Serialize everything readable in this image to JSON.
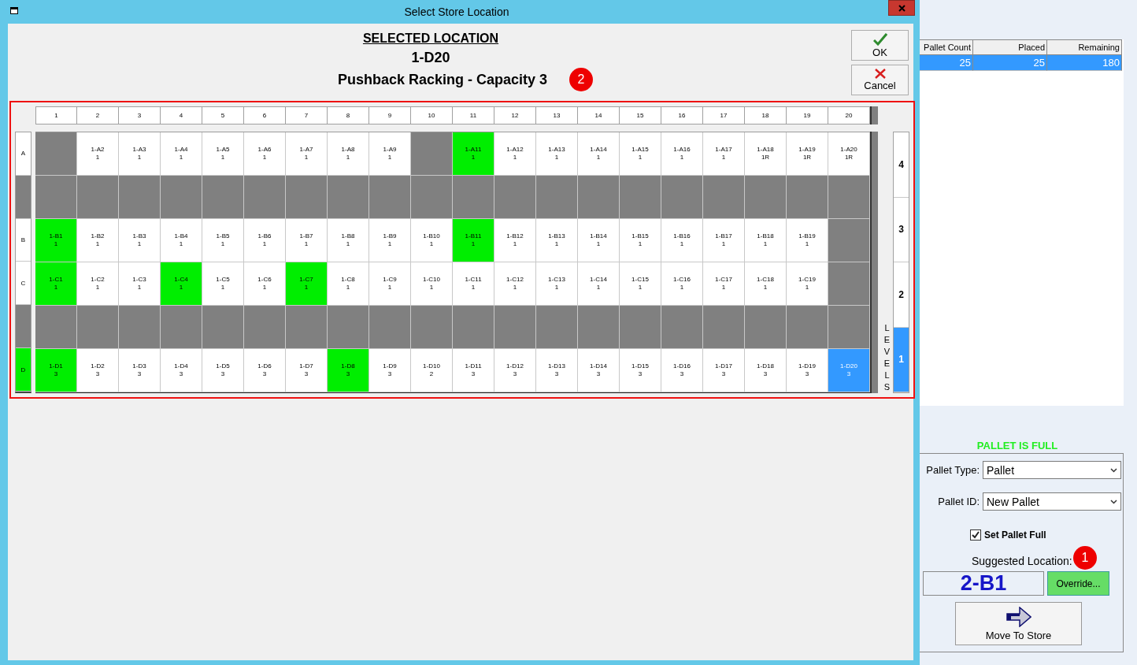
{
  "window": {
    "title": "Select Store Location"
  },
  "header": {
    "heading": "SELECTED LOCATION",
    "location": "1-D20",
    "description": "Pushback Racking - Capacity 3",
    "badge": "2"
  },
  "dialog_buttons": [
    {
      "kind": "ok",
      "label": "OK"
    },
    {
      "kind": "cancel",
      "label": "Cancel"
    }
  ],
  "grid": {
    "columns": [
      "1",
      "2",
      "3",
      "4",
      "5",
      "6",
      "7",
      "8",
      "9",
      "10",
      "11",
      "12",
      "13",
      "14",
      "15",
      "16",
      "17",
      "18",
      "19",
      "20"
    ],
    "rows": [
      {
        "label": "A",
        "color": "#ffffff",
        "cells": [
          {
            "color": "#808080"
          },
          {
            "code": "1-A2",
            "qty": "1",
            "color": "#ffffff",
            "selected": false
          },
          {
            "code": "1-A3",
            "qty": "1",
            "color": "#ffffff",
            "selected": false
          },
          {
            "code": "1-A4",
            "qty": "1",
            "color": "#ffffff",
            "selected": false
          },
          {
            "code": "1-A5",
            "qty": "1",
            "color": "#ffffff",
            "selected": false
          },
          {
            "code": "1-A6",
            "qty": "1",
            "color": "#ffffff",
            "selected": false
          },
          {
            "code": "1-A7",
            "qty": "1",
            "color": "#ffffff",
            "selected": false
          },
          {
            "code": "1-A8",
            "qty": "1",
            "color": "#ffffff",
            "selected": false
          },
          {
            "code": "1-A9",
            "qty": "1",
            "color": "#ffffff",
            "selected": false
          },
          {
            "color": "#808080"
          },
          {
            "code": "1-A11",
            "qty": "1",
            "color": "#00ee00",
            "selected": false
          },
          {
            "code": "1-A12",
            "qty": "1",
            "color": "#ffffff",
            "selected": false
          },
          {
            "code": "1-A13",
            "qty": "1",
            "color": "#ffffff",
            "selected": false
          },
          {
            "code": "1-A14",
            "qty": "1",
            "color": "#ffffff",
            "selected": false
          },
          {
            "code": "1-A15",
            "qty": "1",
            "color": "#ffffff",
            "selected": false
          },
          {
            "code": "1-A16",
            "qty": "1",
            "color": "#ffffff",
            "selected": false
          },
          {
            "code": "1-A17",
            "qty": "1",
            "color": "#ffffff",
            "selected": false
          },
          {
            "code": "1-A18",
            "qty": "1R",
            "color": "#ffffff",
            "selected": false
          },
          {
            "code": "1-A19",
            "qty": "1R",
            "color": "#ffffff",
            "selected": false
          },
          {
            "code": "1-A20",
            "qty": "1R",
            "color": "#ffffff",
            "selected": false
          }
        ]
      },
      {
        "color": "#808080",
        "cells": [
          {
            "color": "#808080"
          },
          {
            "color": "#808080"
          },
          {
            "color": "#808080"
          },
          {
            "color": "#808080"
          },
          {
            "color": "#808080"
          },
          {
            "color": "#808080"
          },
          {
            "color": "#808080"
          },
          {
            "color": "#808080"
          },
          {
            "color": "#808080"
          },
          {
            "color": "#808080"
          },
          {
            "color": "#808080"
          },
          {
            "color": "#808080"
          },
          {
            "color": "#808080"
          },
          {
            "color": "#808080"
          },
          {
            "color": "#808080"
          },
          {
            "color": "#808080"
          },
          {
            "color": "#808080"
          },
          {
            "color": "#808080"
          },
          {
            "color": "#808080"
          },
          {
            "color": "#808080"
          }
        ]
      },
      {
        "label": "B",
        "color": "#ffffff",
        "cells": [
          {
            "code": "1-B1",
            "qty": "1",
            "color": "#00ee00",
            "selected": false
          },
          {
            "code": "1-B2",
            "qty": "1",
            "color": "#ffffff",
            "selected": false
          },
          {
            "code": "1-B3",
            "qty": "1",
            "color": "#ffffff",
            "selected": false
          },
          {
            "code": "1-B4",
            "qty": "1",
            "color": "#ffffff",
            "selected": false
          },
          {
            "code": "1-B5",
            "qty": "1",
            "color": "#ffffff",
            "selected": false
          },
          {
            "code": "1-B6",
            "qty": "1",
            "color": "#ffffff",
            "selected": false
          },
          {
            "code": "1-B7",
            "qty": "1",
            "color": "#ffffff",
            "selected": false
          },
          {
            "code": "1-B8",
            "qty": "1",
            "color": "#ffffff",
            "selected": false
          },
          {
            "code": "1-B9",
            "qty": "1",
            "color": "#ffffff",
            "selected": false
          },
          {
            "code": "1-B10",
            "qty": "1",
            "color": "#ffffff",
            "selected": false
          },
          {
            "code": "1-B11",
            "qty": "1",
            "color": "#00ee00",
            "selected": false
          },
          {
            "code": "1-B12",
            "qty": "1",
            "color": "#ffffff",
            "selected": false
          },
          {
            "code": "1-B13",
            "qty": "1",
            "color": "#ffffff",
            "selected": false
          },
          {
            "code": "1-B14",
            "qty": "1",
            "color": "#ffffff",
            "selected": false
          },
          {
            "code": "1-B15",
            "qty": "1",
            "color": "#ffffff",
            "selected": false
          },
          {
            "code": "1-B16",
            "qty": "1",
            "color": "#ffffff",
            "selected": false
          },
          {
            "code": "1-B17",
            "qty": "1",
            "color": "#ffffff",
            "selected": false
          },
          {
            "code": "1-B18",
            "qty": "1",
            "color": "#ffffff",
            "selected": false
          },
          {
            "code": "1-B19",
            "qty": "1",
            "color": "#ffffff",
            "selected": false
          },
          {
            "color": "#808080"
          }
        ]
      },
      {
        "label": "C",
        "color": "#ffffff",
        "cells": [
          {
            "code": "1-C1",
            "qty": "1",
            "color": "#00ee00",
            "selected": false
          },
          {
            "code": "1-C2",
            "qty": "1",
            "color": "#ffffff",
            "selected": false
          },
          {
            "code": "1-C3",
            "qty": "1",
            "color": "#ffffff",
            "selected": false
          },
          {
            "code": "1-C4",
            "qty": "1",
            "color": "#00ee00",
            "selected": false
          },
          {
            "code": "1-C5",
            "qty": "1",
            "color": "#ffffff",
            "selected": false
          },
          {
            "code": "1-C6",
            "qty": "1",
            "color": "#ffffff",
            "selected": false
          },
          {
            "code": "1-C7",
            "qty": "1",
            "color": "#00ee00",
            "selected": false
          },
          {
            "code": "1-C8",
            "qty": "1",
            "color": "#ffffff",
            "selected": false
          },
          {
            "code": "1-C9",
            "qty": "1",
            "color": "#ffffff",
            "selected": false
          },
          {
            "code": "1-C10",
            "qty": "1",
            "color": "#ffffff",
            "selected": false
          },
          {
            "code": "1-C11",
            "qty": "1",
            "color": "#ffffff",
            "selected": false
          },
          {
            "code": "1-C12",
            "qty": "1",
            "color": "#ffffff",
            "selected": false
          },
          {
            "code": "1-C13",
            "qty": "1",
            "color": "#ffffff",
            "selected": false
          },
          {
            "code": "1-C14",
            "qty": "1",
            "color": "#ffffff",
            "selected": false
          },
          {
            "code": "1-C15",
            "qty": "1",
            "color": "#ffffff",
            "selected": false
          },
          {
            "code": "1-C16",
            "qty": "1",
            "color": "#ffffff",
            "selected": false
          },
          {
            "code": "1-C17",
            "qty": "1",
            "color": "#ffffff",
            "selected": false
          },
          {
            "code": "1-C18",
            "qty": "1",
            "color": "#ffffff",
            "selected": false
          },
          {
            "code": "1-C19",
            "qty": "1",
            "color": "#ffffff",
            "selected": false
          },
          {
            "color": "#808080"
          }
        ]
      },
      {
        "color": "#808080",
        "cells": [
          {
            "color": "#808080"
          },
          {
            "color": "#808080"
          },
          {
            "color": "#808080"
          },
          {
            "color": "#808080"
          },
          {
            "color": "#808080"
          },
          {
            "color": "#808080"
          },
          {
            "color": "#808080"
          },
          {
            "color": "#808080"
          },
          {
            "color": "#808080"
          },
          {
            "color": "#808080"
          },
          {
            "color": "#808080"
          },
          {
            "color": "#808080"
          },
          {
            "color": "#808080"
          },
          {
            "color": "#808080"
          },
          {
            "color": "#808080"
          },
          {
            "color": "#808080"
          },
          {
            "color": "#808080"
          },
          {
            "color": "#808080"
          },
          {
            "color": "#808080"
          },
          {
            "color": "#808080"
          }
        ]
      },
      {
        "label": "D",
        "color": "#00ee00",
        "cells": [
          {
            "code": "1-D1",
            "qty": "3",
            "color": "#00ee00",
            "selected": false
          },
          {
            "code": "1-D2",
            "qty": "3",
            "color": "#ffffff",
            "selected": false
          },
          {
            "code": "1-D3",
            "qty": "3",
            "color": "#ffffff",
            "selected": false
          },
          {
            "code": "1-D4",
            "qty": "3",
            "color": "#ffffff",
            "selected": false
          },
          {
            "code": "1-D5",
            "qty": "3",
            "color": "#ffffff",
            "selected": false
          },
          {
            "code": "1-D6",
            "qty": "3",
            "color": "#ffffff",
            "selected": false
          },
          {
            "code": "1-D7",
            "qty": "3",
            "color": "#ffffff",
            "selected": false
          },
          {
            "code": "1-D8",
            "qty": "3",
            "color": "#00ee00",
            "selected": false
          },
          {
            "code": "1-D9",
            "qty": "3",
            "color": "#ffffff",
            "selected": false
          },
          {
            "code": "1-D10",
            "qty": "2",
            "color": "#ffffff",
            "selected": false
          },
          {
            "code": "1-D11",
            "qty": "3",
            "color": "#ffffff",
            "selected": false
          },
          {
            "code": "1-D12",
            "qty": "3",
            "color": "#ffffff",
            "selected": false
          },
          {
            "code": "1-D13",
            "qty": "3",
            "color": "#ffffff",
            "selected": false
          },
          {
            "code": "1-D14",
            "qty": "3",
            "color": "#ffffff",
            "selected": false
          },
          {
            "code": "1-D15",
            "qty": "3",
            "color": "#ffffff",
            "selected": false
          },
          {
            "code": "1-D16",
            "qty": "3",
            "color": "#ffffff",
            "selected": false
          },
          {
            "code": "1-D17",
            "qty": "3",
            "color": "#ffffff",
            "selected": false
          },
          {
            "code": "1-D18",
            "qty": "3",
            "color": "#ffffff",
            "selected": false
          },
          {
            "code": "1-D19",
            "qty": "3",
            "color": "#ffffff",
            "selected": false
          },
          {
            "code": "1-D20",
            "qty": "3",
            "color": "#3399ff",
            "selected": true
          }
        ]
      }
    ],
    "levels_caption": "LEVELS",
    "levels": [
      {
        "label": "4",
        "selected": false
      },
      {
        "label": "3",
        "selected": false
      },
      {
        "label": "2",
        "selected": false
      },
      {
        "label": "1",
        "selected": true
      }
    ]
  },
  "table": {
    "columns": [
      "Pallet Count",
      "Placed",
      "Remaining"
    ],
    "rows": [
      {
        "cells": [
          "25",
          "25",
          "180"
        ],
        "selected": true
      }
    ]
  },
  "pallet_panel": {
    "status": "PALLET IS FULL",
    "fields": [
      {
        "label": "Pallet Type:",
        "value": "Pallet"
      },
      {
        "label": "Pallet ID:",
        "value": "New Pallet"
      }
    ],
    "checkbox": {
      "label": "Set Pallet Full",
      "checked": true
    },
    "suggested_label": "Suggested Location:",
    "badge": "1",
    "suggested_value": "2-B1",
    "override_button": "Override...",
    "move_button": "Move To Store"
  }
}
